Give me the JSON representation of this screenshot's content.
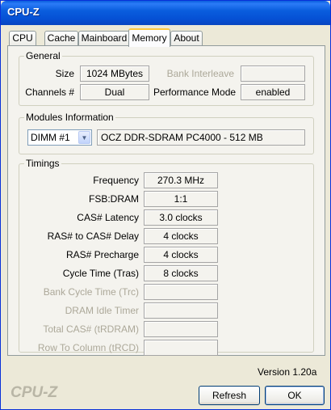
{
  "window": {
    "title": "CPU-Z"
  },
  "tabs": [
    {
      "label": "CPU"
    },
    {
      "label": "Cache"
    },
    {
      "label": "Mainboard"
    },
    {
      "label": "Memory"
    },
    {
      "label": "About"
    }
  ],
  "general": {
    "title": "General",
    "size_label": "Size",
    "size_value": "1024 MBytes",
    "bank_interleave_label": "Bank Interleave",
    "bank_interleave_value": "",
    "channels_label": "Channels #",
    "channels_value": "Dual",
    "performance_mode_label": "Performance Mode",
    "performance_mode_value": "enabled"
  },
  "modules": {
    "title": "Modules Information",
    "slot_selected": "DIMM #1",
    "module_description": "OCZ DDR-SDRAM PC4000 - 512 MB"
  },
  "timings": {
    "title": "Timings",
    "rows": [
      {
        "label": "Frequency",
        "value": "270.3 MHz"
      },
      {
        "label": "FSB:DRAM",
        "value": "1:1"
      },
      {
        "label": "CAS# Latency",
        "value": "3.0 clocks"
      },
      {
        "label": "RAS# to CAS# Delay",
        "value": "4 clocks"
      },
      {
        "label": "RAS# Precharge",
        "value": "4 clocks"
      },
      {
        "label": "Cycle Time (Tras)",
        "value": "8 clocks"
      },
      {
        "label": "Bank Cycle Time (Trc)",
        "value": ""
      },
      {
        "label": "DRAM Idle Timer",
        "value": ""
      },
      {
        "label": "Total CAS# (tRDRAM)",
        "value": ""
      },
      {
        "label": "Row To Column (tRCD)",
        "value": ""
      }
    ]
  },
  "footer": {
    "brand": "CPU-Z",
    "version": "Version 1.20a",
    "refresh_label": "Refresh",
    "ok_label": "OK"
  }
}
